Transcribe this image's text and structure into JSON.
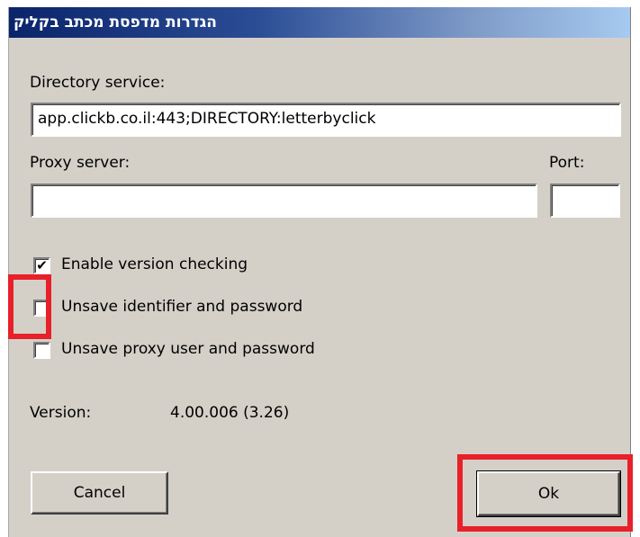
{
  "window": {
    "title": "הגדרות מדפסת מכתב בקליק"
  },
  "directory": {
    "label": "Directory service:",
    "value": "app.clickb.co.il:443;DIRECTORY:letterbyclick"
  },
  "proxy": {
    "label": "Proxy server:",
    "value": "",
    "port_label": "Port:",
    "port_value": ""
  },
  "options": [
    {
      "label": "Enable version checking",
      "checked": true,
      "mark": "✔"
    },
    {
      "label": "Unsave identifier and password",
      "checked": false,
      "mark": ""
    },
    {
      "label": "Unsave proxy user and password",
      "checked": false,
      "mark": ""
    }
  ],
  "version": {
    "label": "Version:",
    "value": "4.00.006 (3.26)"
  },
  "buttons": {
    "cancel_label": "Cancel",
    "ok_label": "Ok"
  },
  "colors": {
    "highlight": "#e8202a",
    "title_bar_start": "#0a246a",
    "title_bar_end": "#a6caf0",
    "dialog_bg": "#d4d0c8"
  }
}
